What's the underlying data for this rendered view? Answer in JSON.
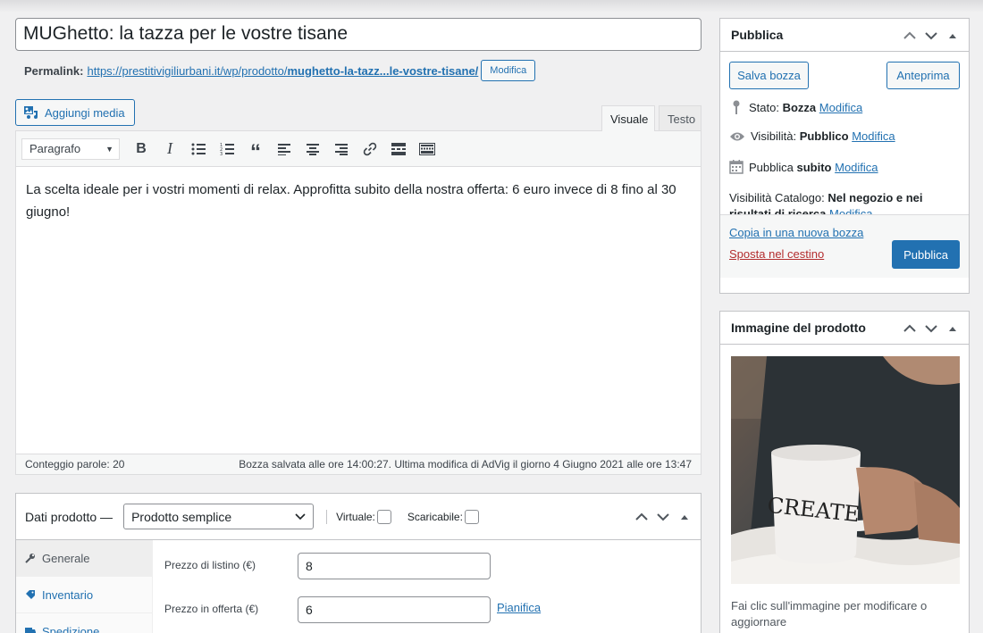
{
  "post": {
    "title": "MUGhetto: la tazza per le vostre tisane",
    "permalink_label": "Permalink:",
    "permalink_base": "https://prestitivigiliurbani.it/wp/prodotto/",
    "permalink_slug": "mughetto-la-tazz...le-vostre-tisane/",
    "permalink_edit": "Modifica"
  },
  "editor": {
    "add_media": "Aggiungi media",
    "tab_visual": "Visuale",
    "tab_text": "Testo",
    "format_select": "Paragrafo",
    "content": "La scelta ideale per i vostri momenti di relax. Approfitta subito della nostra offerta: 6 euro invece di 8 fino al 30 giugno!",
    "word_count": "Conteggio parole: 20",
    "save_status": "Bozza salvata alle ore 14:00:27. Ultima modifica di AdVig il giorno 4 Giugno 2021 alle ore 13:47"
  },
  "product_data": {
    "title": "Dati prodotto —",
    "type": "Prodotto semplice",
    "virtual_label": "Virtuale:",
    "downloadable_label": "Scaricabile:",
    "tabs": [
      {
        "label": "Generale"
      },
      {
        "label": "Inventario"
      },
      {
        "label": "Spedizione"
      }
    ],
    "regular_price_label": "Prezzo di listino (€)",
    "regular_price": "8",
    "sale_price_label": "Prezzo in offerta (€)",
    "sale_price": "6",
    "schedule_link": "Pianifica"
  },
  "publish_box": {
    "title": "Pubblica",
    "save_draft": "Salva bozza",
    "preview": "Anteprima",
    "status_label": "Stato:",
    "status_value": "Bozza",
    "visibility_label": "Visibilità:",
    "visibility_value": "Pubblico",
    "publish_label": "Pubblica",
    "publish_value": "subito",
    "edit": "Modifica",
    "catalog_label": "Visibilità Catalogo:",
    "catalog_value_1": "Nel negozio e nei",
    "catalog_value_2": "risultati di ricerca",
    "copy_draft": "Copia in una nuova bozza",
    "trash": "Sposta nel cestino",
    "publish_button": "Pubblica"
  },
  "image_box": {
    "title": "Immagine del prodotto",
    "mug_text": "CREATE",
    "help_1": "Fai clic sull'immagine per modificare o",
    "help_2": "aggiornare"
  },
  "colors": {
    "accent": "#2271b1",
    "danger": "#b32d2e"
  }
}
